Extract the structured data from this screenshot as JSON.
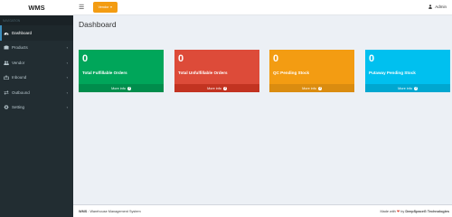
{
  "brand": {
    "logo": "WMS"
  },
  "topbar": {
    "vendor_label": "Vendor",
    "user_name": "Admin"
  },
  "sidebar": {
    "header": "NAVIGATION",
    "items": [
      {
        "label": "Dashboard",
        "icon": "dashboard-icon",
        "active": true
      },
      {
        "label": "Products",
        "icon": "products-icon"
      },
      {
        "label": "Vendor",
        "icon": "users-icon"
      },
      {
        "label": "Inbound",
        "icon": "inbound-icon"
      },
      {
        "label": "Outbound",
        "icon": "outbound-icon"
      },
      {
        "label": "Setting",
        "icon": "gear-icon"
      }
    ]
  },
  "main": {
    "title": "Dashboard",
    "boxes": [
      {
        "count": "0",
        "label": "Total Fulfillable Orders",
        "more": "More info",
        "color": "#00a65a"
      },
      {
        "count": "0",
        "label": "Total Unfulfillable Orders",
        "more": "More info",
        "color": "#dd4b39"
      },
      {
        "count": "0",
        "label": "QC Pending Stock",
        "more": "More info",
        "color": "#f39c12"
      },
      {
        "count": "0",
        "label": "Putaway Pending Stock",
        "more": "More info",
        "color": "#00c0ef"
      }
    ]
  },
  "footer": {
    "app_abbr": "WMS",
    "app_desc": " : Warehouse Management System",
    "made_with": "Made with",
    "by": " by ",
    "company": "DeepSpaceG Technologies"
  }
}
